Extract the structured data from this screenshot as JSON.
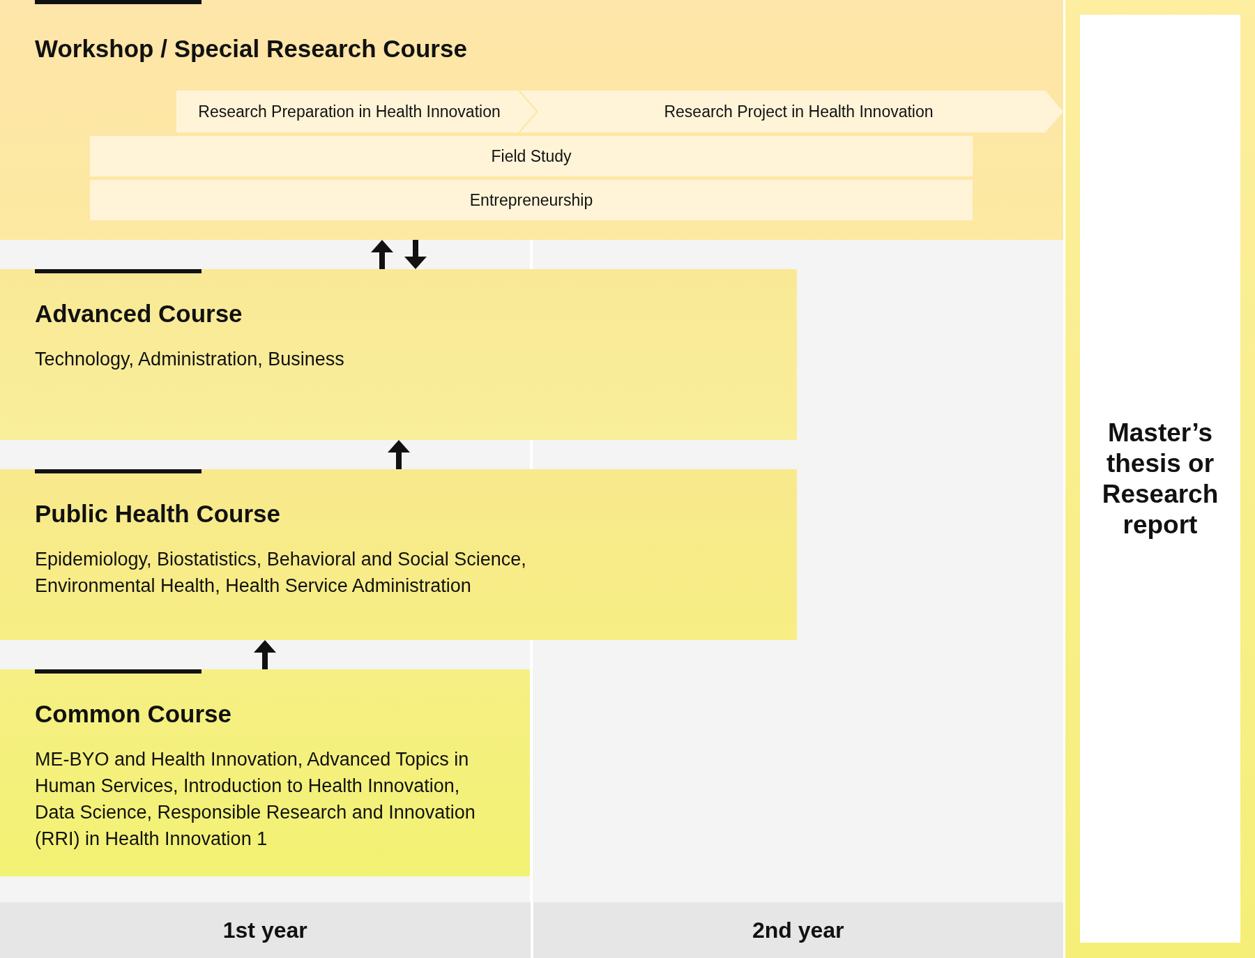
{
  "workshop": {
    "title": "Workshop / Special Research Course",
    "steps": [
      "Research Preparation in Health Innovation",
      "Research Project in Health Innovation"
    ],
    "bars": [
      "Field Study",
      "Entrepreneurship"
    ]
  },
  "courses": [
    {
      "title": "Advanced Course",
      "description": "Technology, Administration, Business"
    },
    {
      "title": "Public Health Course",
      "description": "Epidemiology, Biostatistics, Behavioral and Social Science, Environmental Health, Health Service Administration"
    },
    {
      "title": "Common Course",
      "description": "ME-BYO and Health Innovation, Advanced Topics in Human Services, Introduction to Health Innovation, Data Science, Responsible Research and Innovation (RRI) in Health Innovation 1"
    }
  ],
  "thesis": {
    "title": "Master’s thesis or Research report"
  },
  "years": [
    "1st year",
    "2nd year"
  ]
}
